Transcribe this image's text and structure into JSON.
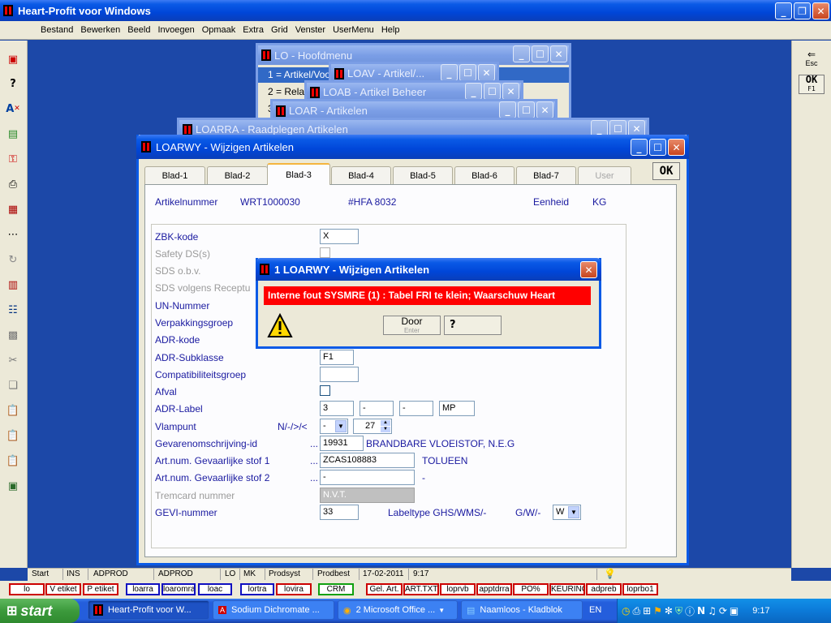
{
  "app": {
    "title": "Heart-Profit voor Windows",
    "menu": [
      "Bestand",
      "Bewerken",
      "Beeld",
      "Invoegen",
      "Opmaak",
      "Extra",
      "Grid",
      "Venster",
      "UserMenu",
      "Help"
    ]
  },
  "right_toolbar": {
    "esc_label": "Esc",
    "ok_label": "OK",
    "ok_key": "F1"
  },
  "stacked_windows": [
    {
      "title": "LO - Hoofdmenu"
    },
    {
      "title": "LOAV - Artikel/..."
    },
    {
      "title": "LOAB - Artikel Beheer"
    },
    {
      "title": "LOAR - Artikelen"
    },
    {
      "title": "LOARRA - Raadplegen Artikelen"
    }
  ],
  "hoofdmenu_items": [
    "1 = Artikel/Voo",
    "2 = Rela",
    "3"
  ],
  "main_window": {
    "title": "LOARWY - Wijzigen Artikelen",
    "ok_label": "OK",
    "tabs": [
      "Blad-1",
      "Blad-2",
      "Blad-3",
      "Blad-4",
      "Blad-5",
      "Blad-6",
      "Blad-7",
      "User"
    ],
    "active_tab": "Blad-3",
    "header": {
      "artikelnummer_label": "Artikelnummer",
      "artikelnummer": "WRT1000030",
      "code": "#HFA 8032",
      "eenheid_label": "Eenheid",
      "eenheid": "KG"
    },
    "fields": {
      "zbk_label": "ZBK-kode",
      "zbk": "X",
      "safety_label": "Safety DS(s)",
      "sds_obv_label": "SDS o.b.v.",
      "sds_volgens_label": "SDS volgens Receptu",
      "un_label": "UN-Nummer",
      "verpakking_label": "Verpakkingsgroep",
      "adr_kode_label": "ADR-kode",
      "adr_sub_label": "ADR-Subklasse",
      "adr_sub": "F1",
      "compat_label": "Compatibiliteitsgroep",
      "afval_label": "Afval",
      "adr_label_label": "ADR-Label",
      "adr_label_values": [
        "3",
        "-",
        "-",
        "MP"
      ],
      "vlampunt_label": "Vlampunt",
      "vlampunt_ops": "N/-/>/<",
      "vlampunt_op": "-",
      "vlampunt_value": "27",
      "gevaren_label": "Gevarenomschrijving-id",
      "gevaren_id": "19931",
      "gevaren_desc": "BRANDBARE VLOEISTOF, N.E.G",
      "artnum1_label": "Art.num. Gevaarlijke stof 1",
      "artnum1": "ZCAS108883",
      "artnum1_desc": "TOLUEEN",
      "artnum2_label": "Art.num. Gevaarlijke stof 2",
      "artnum2": "-",
      "artnum2_desc": "-",
      "tremcard_label": "Tremcard nummer",
      "tremcard": "N.V.T.",
      "gevi_label": "GEVI-nummer",
      "gevi": "33",
      "labeltype_label": "Labeltype GHS/WMS/-",
      "gw_label": "G/W/-",
      "gw_value": "W",
      "dots": "..."
    }
  },
  "dialog": {
    "title": "1 LOARWY - Wijzigen Artikelen",
    "message": "Interne fout SYSMRE (1) : Tabel FRI te klein; Waarschuw Heart",
    "door_label": "Door",
    "door_sub": "Enter"
  },
  "statusbar": [
    "Start",
    "INS",
    "ADPROD",
    "ADPROD",
    "LO",
    "MK",
    "Prodsyst",
    "Prodbest",
    "17-02-2011",
    "9:17"
  ],
  "quickbar": [
    "lo",
    "V etiket",
    "P etiket",
    "loarra",
    "loaromra",
    "loac",
    "lortra",
    "lovira",
    "CRM",
    "Gel. Art.",
    "ART.TXT",
    "loprvb",
    "apptdrra",
    "PO%",
    "KEURING",
    "adpreb",
    "loprbo1"
  ],
  "taskbar": {
    "start_label": "start",
    "tasks": [
      "Heart-Profit voor W...",
      "Sodium Dichromate ...",
      "2 Microsoft Office ...",
      "Naamloos - Kladblok"
    ],
    "lang": "EN",
    "clock": "9:17"
  },
  "colors": {
    "error_red": "#ff0000",
    "label_blue": "#1a1aa0",
    "xp_blue": "#0a5ae6"
  }
}
